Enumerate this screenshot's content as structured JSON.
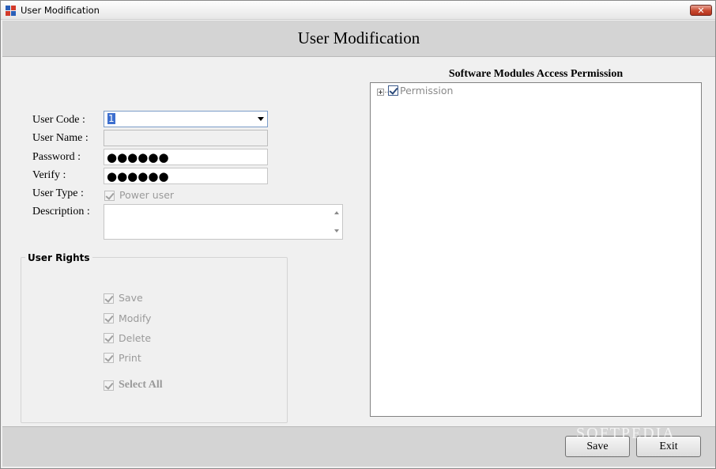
{
  "window": {
    "title": "User Modification"
  },
  "header": {
    "title": "User Modification"
  },
  "form": {
    "user_code_label": "User Code :",
    "user_code_value": "1",
    "user_name_label": "User Name :",
    "user_name_value": "",
    "password_label": "Password :",
    "password_value": "●●●●●●",
    "verify_label": "Verify :",
    "verify_value": "●●●●●●",
    "user_type_label": "User Type :",
    "user_type_option": "Power user",
    "description_label": "Description :",
    "description_value": ""
  },
  "user_rights": {
    "title": "User Rights",
    "items": [
      "Save",
      "Modify",
      "Delete",
      "Print"
    ],
    "select_all": "Select All"
  },
  "permissions": {
    "title": "Software Modules Access Permission",
    "root_node": "Permission"
  },
  "footer": {
    "save_label": "Save",
    "exit_label": "Exit"
  },
  "watermark": "SOFTPEDIA"
}
